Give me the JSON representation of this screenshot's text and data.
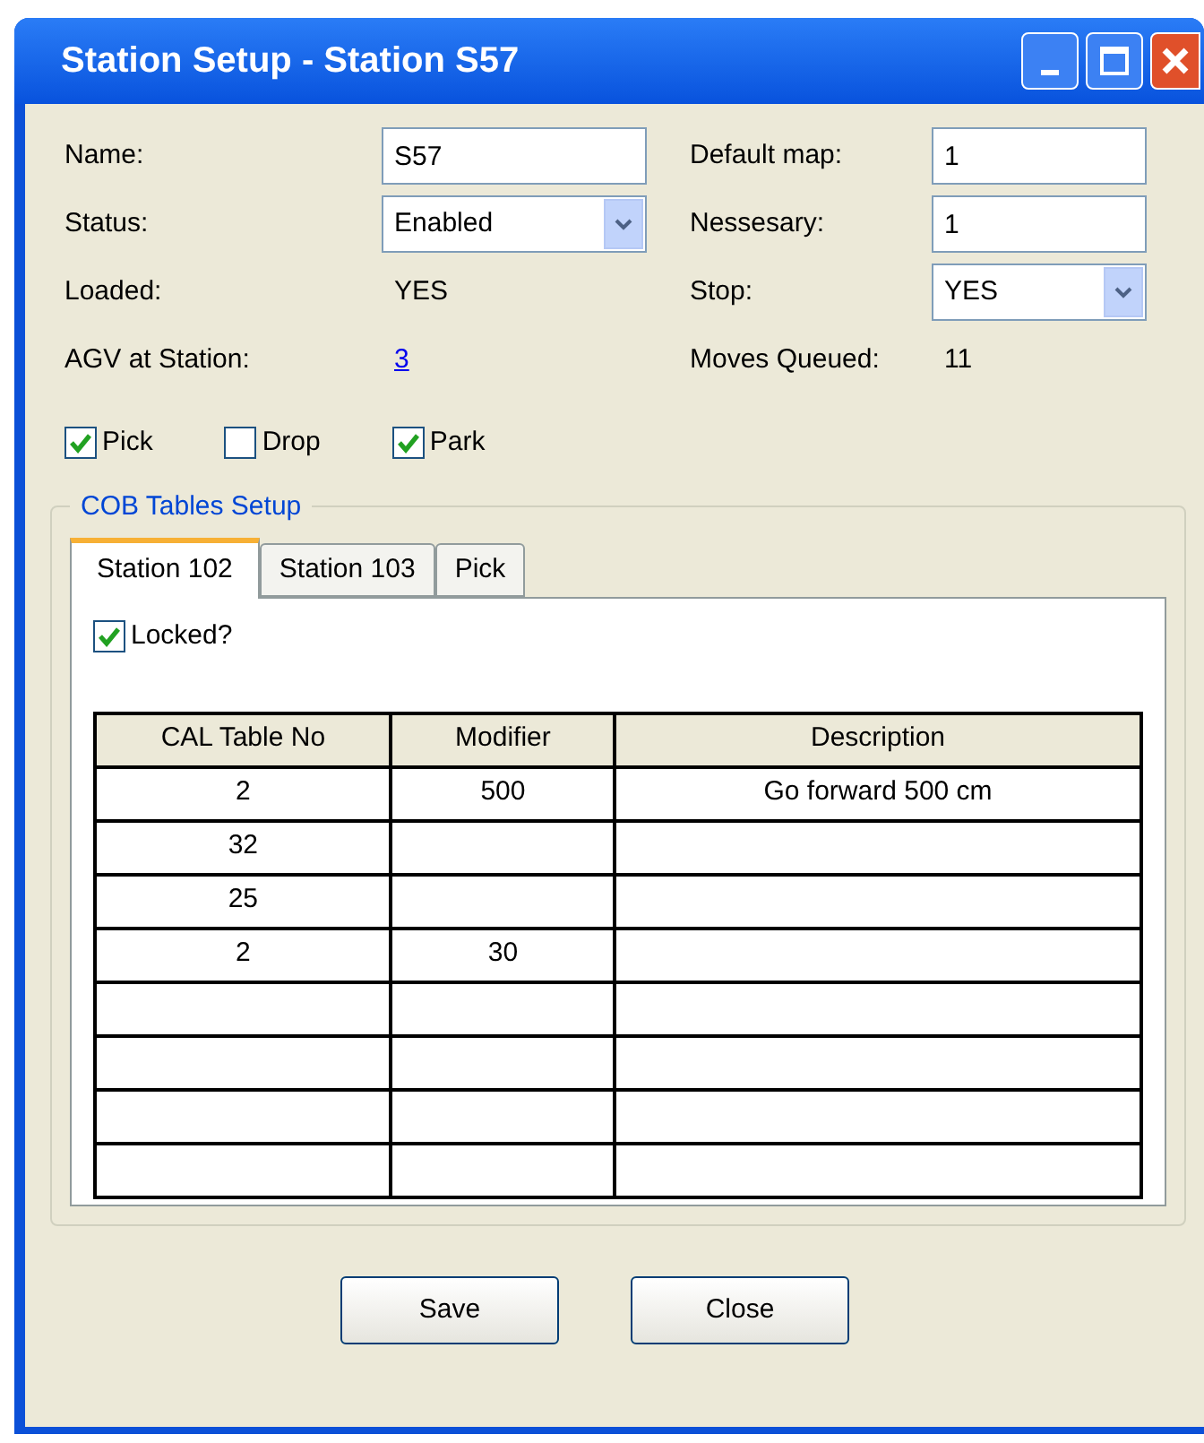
{
  "window": {
    "title": "Station Setup - Station S57"
  },
  "left_fields": [
    {
      "kind": "text_field",
      "label": "Name:",
      "value": "S57"
    },
    {
      "kind": "dropdown",
      "label": "Status:",
      "value": "Enabled"
    },
    {
      "kind": "value",
      "label": "Loaded:",
      "value": "YES"
    },
    {
      "kind": "link",
      "label": "AGV at Station:",
      "value": "3"
    }
  ],
  "right_fields": [
    {
      "kind": "text_field",
      "label": "Default map:",
      "value": "1"
    },
    {
      "kind": "text_field",
      "label": "Nessesary:",
      "value": "1"
    },
    {
      "kind": "dropdown",
      "label": "Stop:",
      "value": "YES"
    },
    {
      "kind": "value",
      "label": "Moves Queued:",
      "value": "11"
    }
  ],
  "options": [
    {
      "label": "Pick",
      "checked": true
    },
    {
      "label": "Drop",
      "checked": false
    },
    {
      "label": "Park",
      "checked": true
    }
  ],
  "group": {
    "title": "COB Tables Setup",
    "tabs": [
      {
        "label": "Station 102",
        "selected": true
      },
      {
        "label": "Station 103",
        "selected": false
      },
      {
        "label": "Pick",
        "selected": false
      }
    ],
    "locked": {
      "label": "Locked?",
      "checked": true
    },
    "table": {
      "columns": [
        "CAL Table No",
        "Modifier",
        "Description"
      ],
      "rows": [
        {
          "cells": [
            "2",
            "500",
            "Go forward 500 cm"
          ]
        },
        {
          "cells": [
            "32"
          ]
        },
        {
          "cells": [
            "25"
          ]
        },
        {
          "cells": [
            "2",
            "30"
          ]
        },
        {
          "cells": []
        },
        {
          "cells": []
        },
        {
          "cells": []
        },
        {
          "cells": []
        }
      ]
    }
  },
  "buttons": [
    "Save",
    "Close"
  ]
}
